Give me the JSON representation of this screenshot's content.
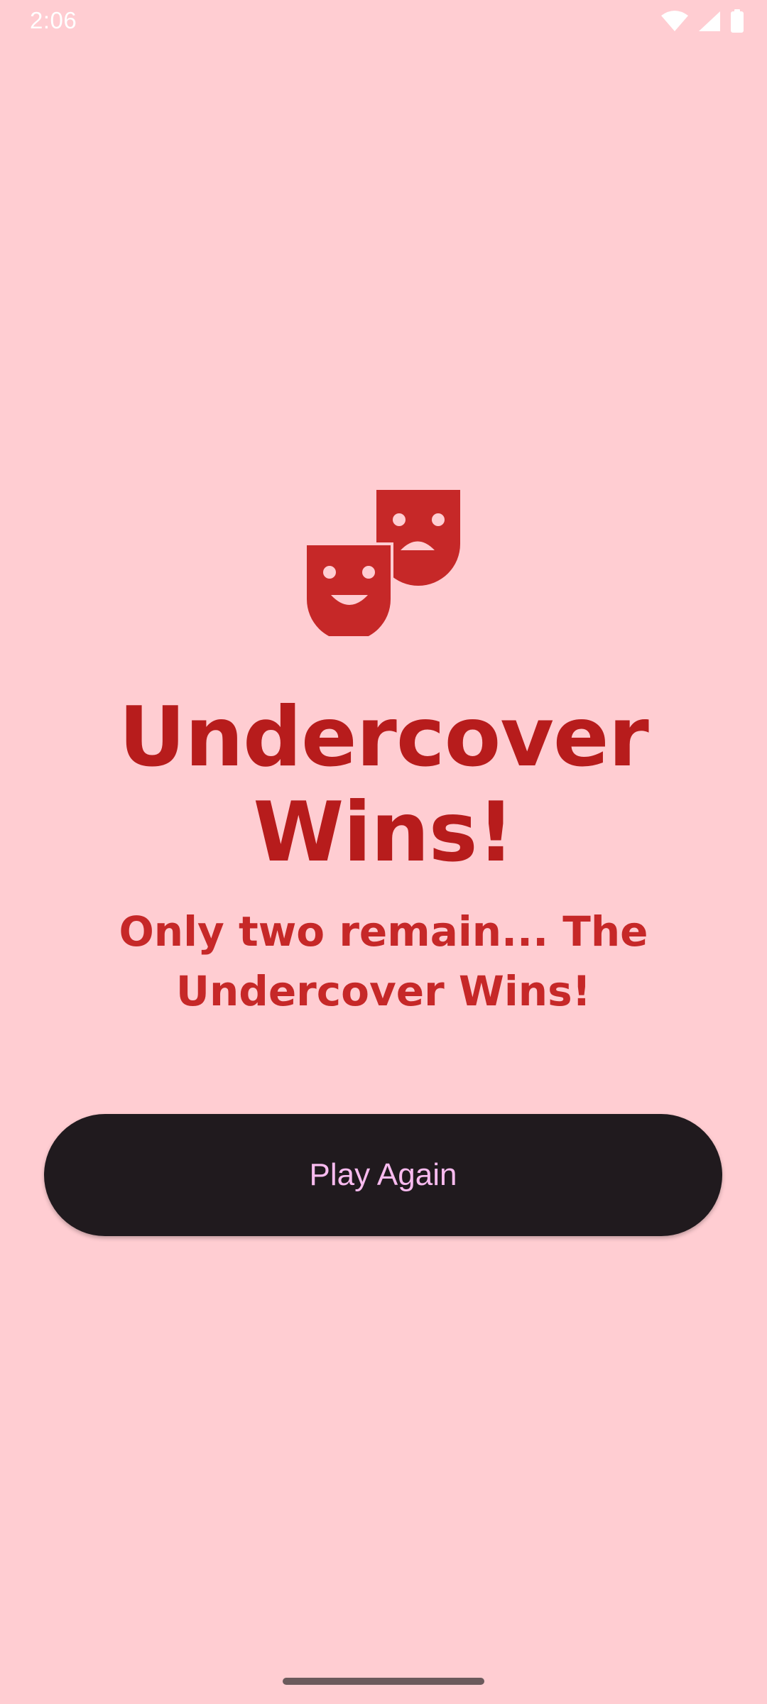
{
  "status_bar": {
    "time": "2:06",
    "icons": [
      "wifi-icon",
      "cellular-signal-icon",
      "battery-icon"
    ]
  },
  "result": {
    "icon": "theater-masks-icon",
    "title": "Undercover Wins!",
    "subtitle": "Only two remain... The Undercover Wins!"
  },
  "actions": {
    "play_again_label": "Play Again"
  },
  "colors": {
    "background": "#ffcdd2",
    "accent": "#b71c1c",
    "button_bg": "#201a1e",
    "button_text": "#f8bbef"
  }
}
